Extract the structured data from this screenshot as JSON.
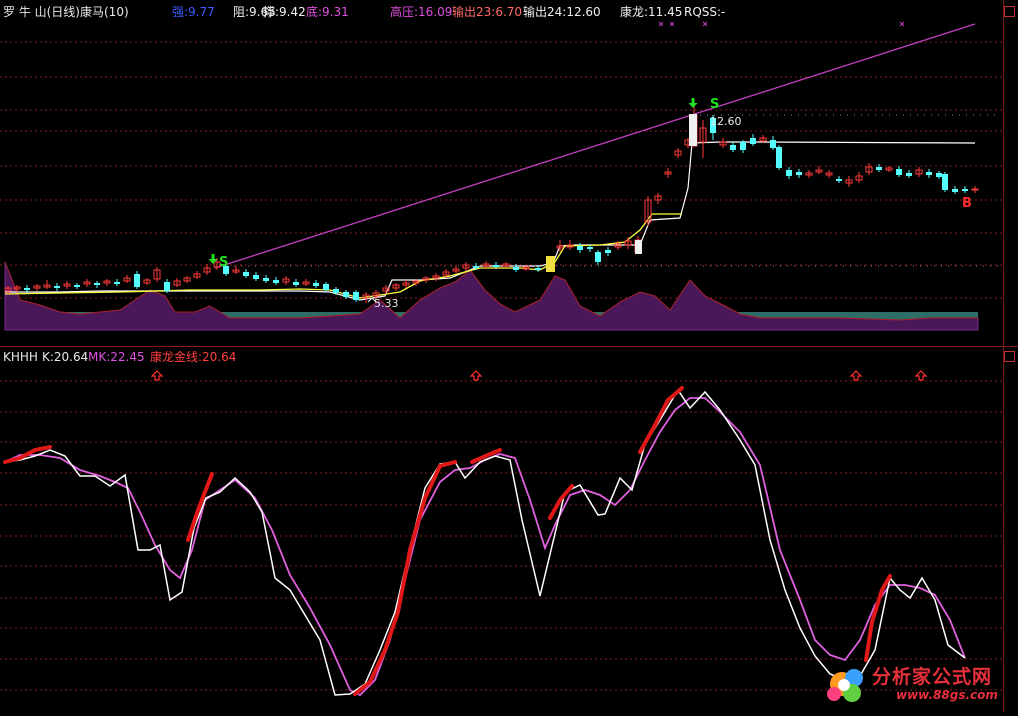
{
  "header": {
    "stock": "罗 牛 山(日线)",
    "formula": "康马(10)",
    "strong": "强:9.77",
    "resist": "阻:9.65",
    "support": "撑:9.42",
    "bottom": "底:9.31",
    "high_pressure": "高压:16.09",
    "output1": "输出23:6.70",
    "output2": "输出24:12.60",
    "kanglong": "康龙:11.45",
    "rqss": "RQSS:-"
  },
  "price_panel": {
    "high_label": "12.60",
    "low_label": "5.33",
    "signal_s1": "S",
    "signal_s2": "S",
    "signal_b": "B"
  },
  "indicator_panel": {
    "name": "KHHH",
    "k": "K:20.64",
    "mk": "MK:22.45",
    "golden": "康龙金线:20.64"
  },
  "colors": {
    "bull": "#ff3a3a",
    "bear": "#54ffff",
    "ma_white": "#ffffff",
    "ma_yellow": "#ffff40",
    "trend_line": "#c040c0",
    "k_line": "#ffffff",
    "mk_line": "#e060e0",
    "golden_line": "#e01818",
    "grid": "#8a1a1a"
  },
  "watermark": {
    "title": "分析家公式网",
    "url": "www.88gs.com"
  }
}
